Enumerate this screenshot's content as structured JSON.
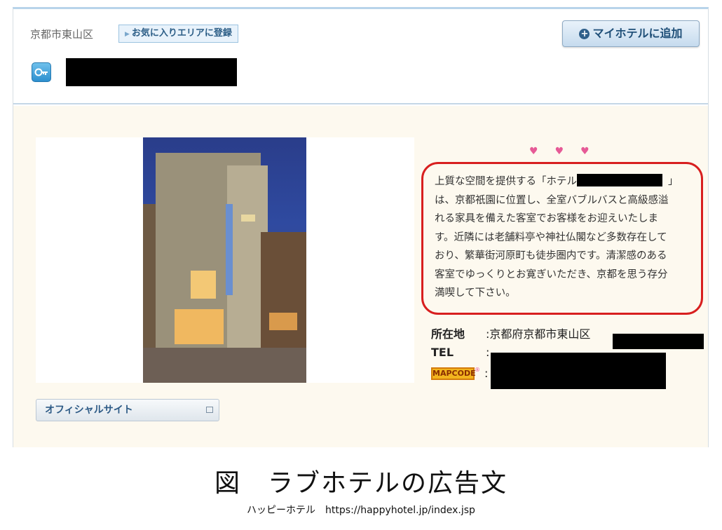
{
  "header": {
    "area": "京都市東山区",
    "fav_area_button": "お気に入りエリアに登録",
    "add_myhotel_button": "マイホテルに追加"
  },
  "description": {
    "lines": [
      "上質な空間を提供する「ホテル",
      "」",
      "は、京都祇園に位置し、全室バブルバスと高級感溢",
      "れる家具を備えた客室でお客様をお迎えいたしま",
      "す。近隣には老舗料亭や神社仏閣など多数存在して",
      "おり、繁華街河原町も徒歩圏内です。清潔感のある",
      "客室でゆっくりとお寛ぎいただき、京都を思う存分",
      "満喫して下さい。"
    ]
  },
  "info": {
    "address_label": "所在地",
    "address_value": ":京都府京都市東山区",
    "tel_label": "TEL",
    "tel_sep": ":",
    "mapcode_logo": "MAPCODE",
    "mapcode_sep": ":"
  },
  "official_site_button": "オフィシャルサイト",
  "caption": "図　ラブホテルの広告文",
  "source": "ハッピーホテル　https://happyhotel.jp/index.jsp",
  "colors": {
    "accent_blue": "#2b5d86",
    "panel_bg": "#fdf9ef",
    "highlight_red": "#d81f1f",
    "heart_pink": "#e65a96"
  },
  "icons": [
    "key-icon",
    "plus-icon",
    "triangle-icon",
    "heart-icon",
    "external-link-icon"
  ]
}
